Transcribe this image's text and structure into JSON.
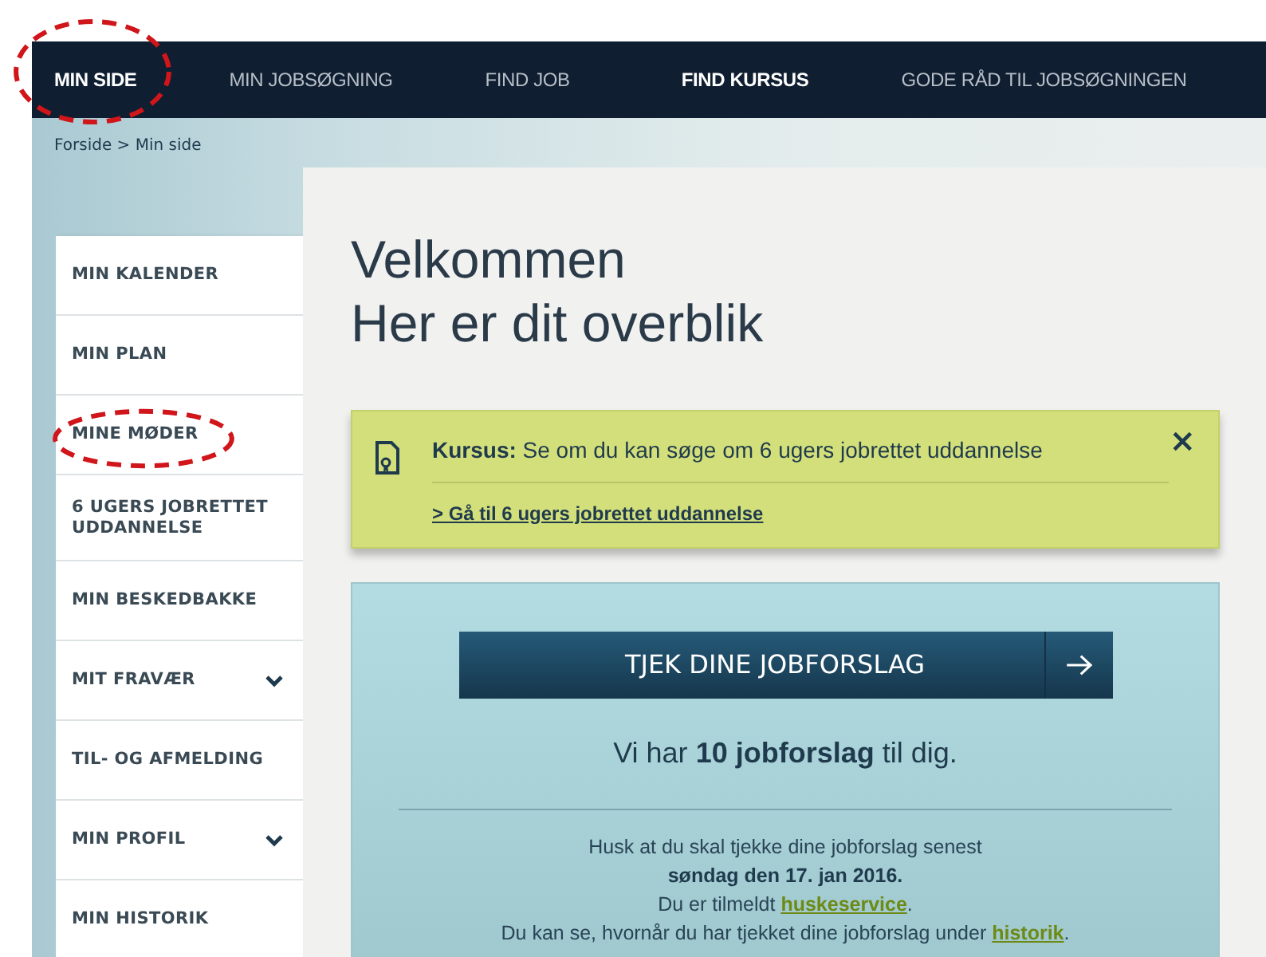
{
  "nav": [
    {
      "label": "MIN SIDE",
      "bold": true,
      "circled": true
    },
    {
      "label": "MIN JOBSØGNING",
      "bold": false,
      "circled": false
    },
    {
      "label": "FIND JOB",
      "bold": false,
      "circled": false
    },
    {
      "label": "FIND KURSUS",
      "bold": true,
      "circled": false
    },
    {
      "label": "GODE RÅD TIL JOBSØGNINGEN",
      "bold": false,
      "circled": false
    }
  ],
  "breadcrumb": "Forside > Min side",
  "sidebar": {
    "items": [
      {
        "label": "MIN KALENDER",
        "expandable": false,
        "circled": false
      },
      {
        "label": "MIN PLAN",
        "expandable": false,
        "circled": false
      },
      {
        "label": "MINE MØDER",
        "expandable": false,
        "circled": true
      },
      {
        "label": "6 UGERS JOBRETTET UDDANNELSE",
        "expandable": false,
        "circled": false
      },
      {
        "label": "MIN BESKEDBAKKE",
        "expandable": false,
        "circled": false
      },
      {
        "label": "MIT FRAVÆR",
        "expandable": true,
        "circled": false
      },
      {
        "label": "TIL- OG AFMELDING",
        "expandable": false,
        "circled": false
      },
      {
        "label": "MIN PROFIL",
        "expandable": true,
        "circled": false
      },
      {
        "label": "MIN HISTORIK",
        "expandable": false,
        "circled": false
      }
    ]
  },
  "heading": [
    "Velkommen",
    "Her er dit overblik"
  ],
  "notice": {
    "text": "**Kursus:** Se om du kan søge om 6 ugers jobrettet uddannelse",
    "link": "> Gå til 6 ugers jobrettet uddannelse",
    "close": "×"
  },
  "jobs": {
    "button": "TJEK DINE JOBFORSLAG",
    "summary": "Vi har **10 jobforslag** til dig.",
    "reminder": [
      {
        "text": "Husk at du skal tjekke dine jobforslag senest",
        "bold": false
      },
      {
        "text": "søndag den 17. jan 2016.",
        "bold": true
      },
      {
        "text": "Du er tilmeldt ",
        "link": "huskeservice",
        "after": ".",
        "bold": false
      },
      {
        "text": "Du kan se, hvornår du har tjekket dine jobforslag under ",
        "link": "historik",
        "after": ".",
        "bold": false
      }
    ]
  }
}
